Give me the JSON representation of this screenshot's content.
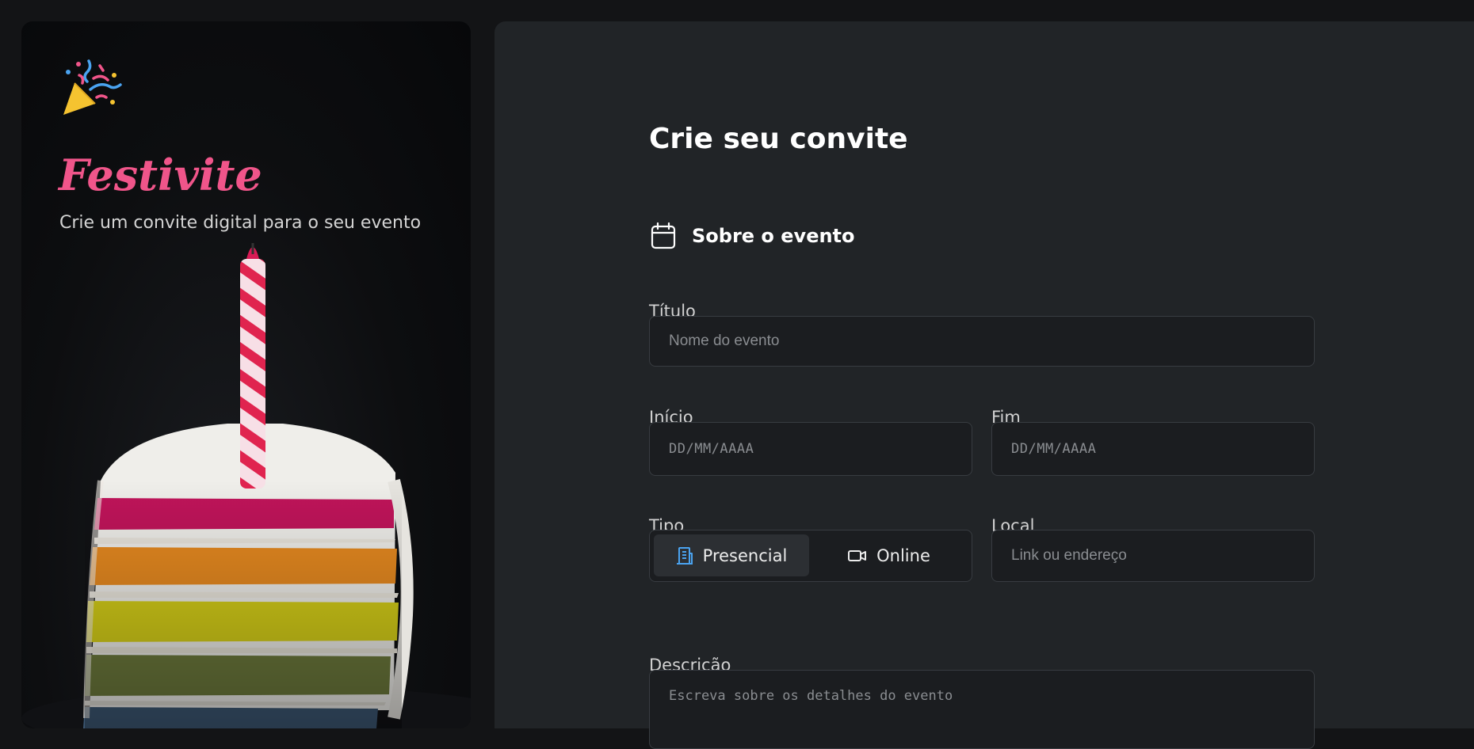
{
  "brand": {
    "name": "Festivite",
    "tagline": "Crie um convite digital para o seu evento",
    "icon": "party-popper-icon"
  },
  "form": {
    "title": "Crie seu convite",
    "section": {
      "icon": "calendar-icon",
      "title": "Sobre o evento"
    },
    "fields": {
      "titulo": {
        "label": "Título",
        "placeholder": "Nome do evento"
      },
      "inicio": {
        "label": "Início",
        "placeholder": "DD/MM/AAAA"
      },
      "fim": {
        "label": "Fim",
        "placeholder": "DD/MM/AAAA"
      },
      "tipo": {
        "label": "Tipo",
        "options": [
          {
            "label": "Presencial",
            "icon": "building-icon",
            "selected": true
          },
          {
            "label": "Online",
            "icon": "video-camera-icon",
            "selected": false
          }
        ]
      },
      "local": {
        "label": "Local",
        "placeholder": "Link ou endereço"
      },
      "descricao": {
        "label": "Descrição",
        "placeholder": "Escreva sobre os detalhes do evento"
      }
    }
  },
  "colors": {
    "brand": "#f0558a",
    "accent_blue": "#4aa3f0",
    "background": "#131416",
    "panel": "#212427",
    "input_bg": "#1b1d20",
    "input_border": "#383c41"
  }
}
